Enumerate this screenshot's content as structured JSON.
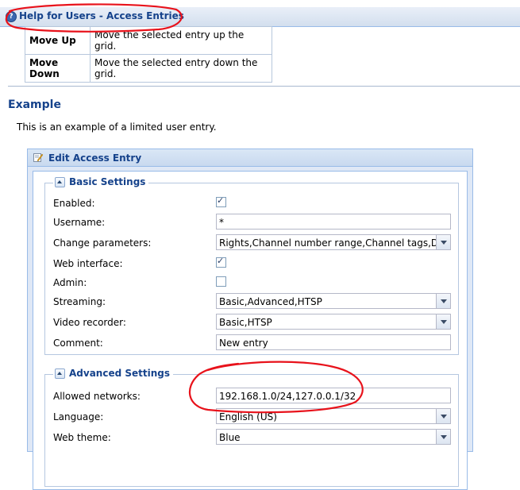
{
  "help": {
    "icon": "help-icon",
    "title": "Help for Users - Access Entries",
    "rows": [
      {
        "key": "Move Up",
        "desc": "Move the selected entry up the grid."
      },
      {
        "key": "Move Down",
        "desc": "Move the selected entry down the grid."
      }
    ]
  },
  "example": {
    "title": "Example",
    "text": "This is an example of a limited user entry."
  },
  "panel": {
    "title": "Edit Access Entry",
    "icon": "edit-icon",
    "basic": {
      "title": "Basic Settings",
      "fields": {
        "enabled": {
          "label": "Enabled:",
          "checked": true
        },
        "username": {
          "label": "Username:",
          "value": "*"
        },
        "change": {
          "label": "Change parameters:",
          "value": "Rights,Channel number range,Channel tags,DVR co"
        },
        "web": {
          "label": "Web interface:",
          "checked": true
        },
        "admin": {
          "label": "Admin:",
          "checked": false
        },
        "streaming": {
          "label": "Streaming:",
          "value": "Basic,Advanced,HTSP"
        },
        "recorder": {
          "label": "Video recorder:",
          "value": "Basic,HTSP"
        },
        "comment": {
          "label": "Comment:",
          "value": "New entry"
        }
      }
    },
    "advanced": {
      "title": "Advanced Settings",
      "fields": {
        "networks": {
          "label": "Allowed networks:",
          "value": "192.168.1.0/24,127.0.0.1/32"
        },
        "language": {
          "label": "Language:",
          "value": "English (US)"
        },
        "theme": {
          "label": "Web theme:",
          "value": "Blue"
        }
      }
    }
  },
  "annotation_color": "#e8121b"
}
